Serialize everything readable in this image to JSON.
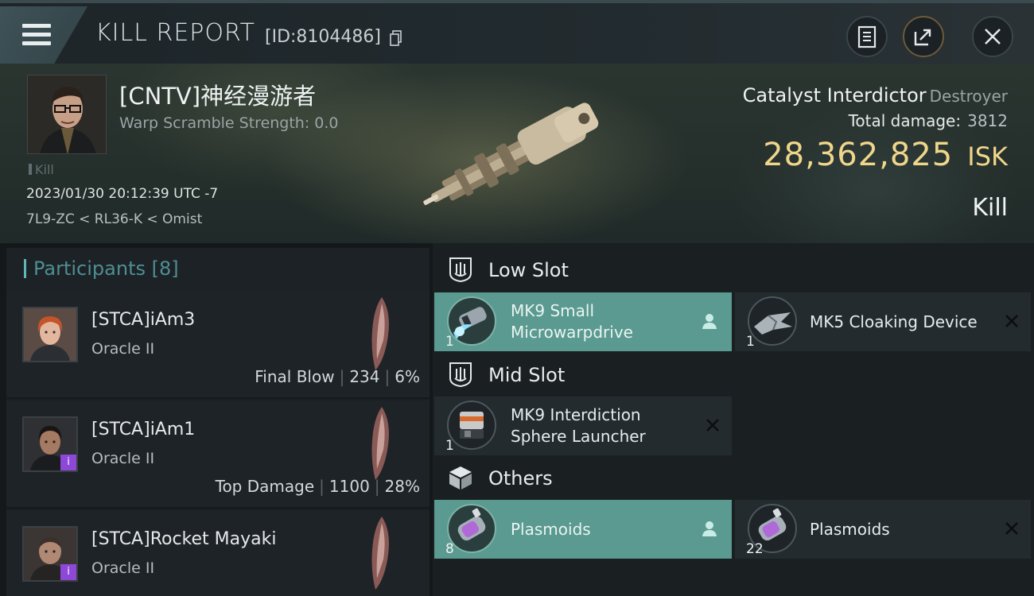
{
  "header": {
    "title": "KILL REPORT",
    "report_id": "[ID:8104486]"
  },
  "victim": {
    "name": "[CNTV]神经漫游者",
    "warp_scramble": "Warp Scramble Strength: 0.0",
    "tag": "Kill",
    "time": "2023/01/30 20:12:39 UTC -7",
    "location": "7L9-ZC < RL36-K < Omist"
  },
  "ship": {
    "name": "Catalyst Interdictor",
    "class": "Destroyer",
    "total_damage_label": "Total damage:",
    "total_damage": "3812",
    "isk_value": "28,362,825",
    "isk_unit": "ISK",
    "result": "Kill"
  },
  "participants": {
    "label": "Participants [8]",
    "rows": [
      {
        "name": "[STCA]iAm3",
        "ship": "Oracle II",
        "role": "Final Blow",
        "damage": "234",
        "percent": "6%",
        "badge": ""
      },
      {
        "name": "[STCA]iAm1",
        "ship": "Oracle II",
        "role": "Top Damage",
        "damage": "1100",
        "percent": "28%",
        "badge": "i"
      },
      {
        "name": "[STCA]Rocket Mayaki",
        "ship": "Oracle II",
        "role": "",
        "damage": "",
        "percent": "",
        "badge": "i"
      }
    ]
  },
  "slots": {
    "low": {
      "label": "Low Slot",
      "items": [
        {
          "qty": "1",
          "line1": "MK9 Small",
          "line2": "Microwarpdrive"
        },
        {
          "qty": "1",
          "line1": "MK5 Cloaking Device",
          "line2": ""
        }
      ]
    },
    "mid": {
      "label": "Mid Slot",
      "items": [
        {
          "qty": "1",
          "line1": "MK9 Interdiction",
          "line2": "Sphere Launcher"
        }
      ]
    },
    "others": {
      "label": "Others",
      "items": [
        {
          "qty": "8",
          "line1": "Plasmoids",
          "line2": ""
        },
        {
          "qty": "22",
          "line1": "Plasmoids",
          "line2": ""
        }
      ]
    }
  },
  "colors": {
    "accent_teal": "#5a9a90",
    "isk_gold": "#f0d68a",
    "badge_purple": "#8d48d8"
  },
  "icons": [
    "menu-icon",
    "copy-icon",
    "clipboard-icon",
    "share-icon",
    "close-icon",
    "slot-icon",
    "cube-icon",
    "person-icon"
  ]
}
